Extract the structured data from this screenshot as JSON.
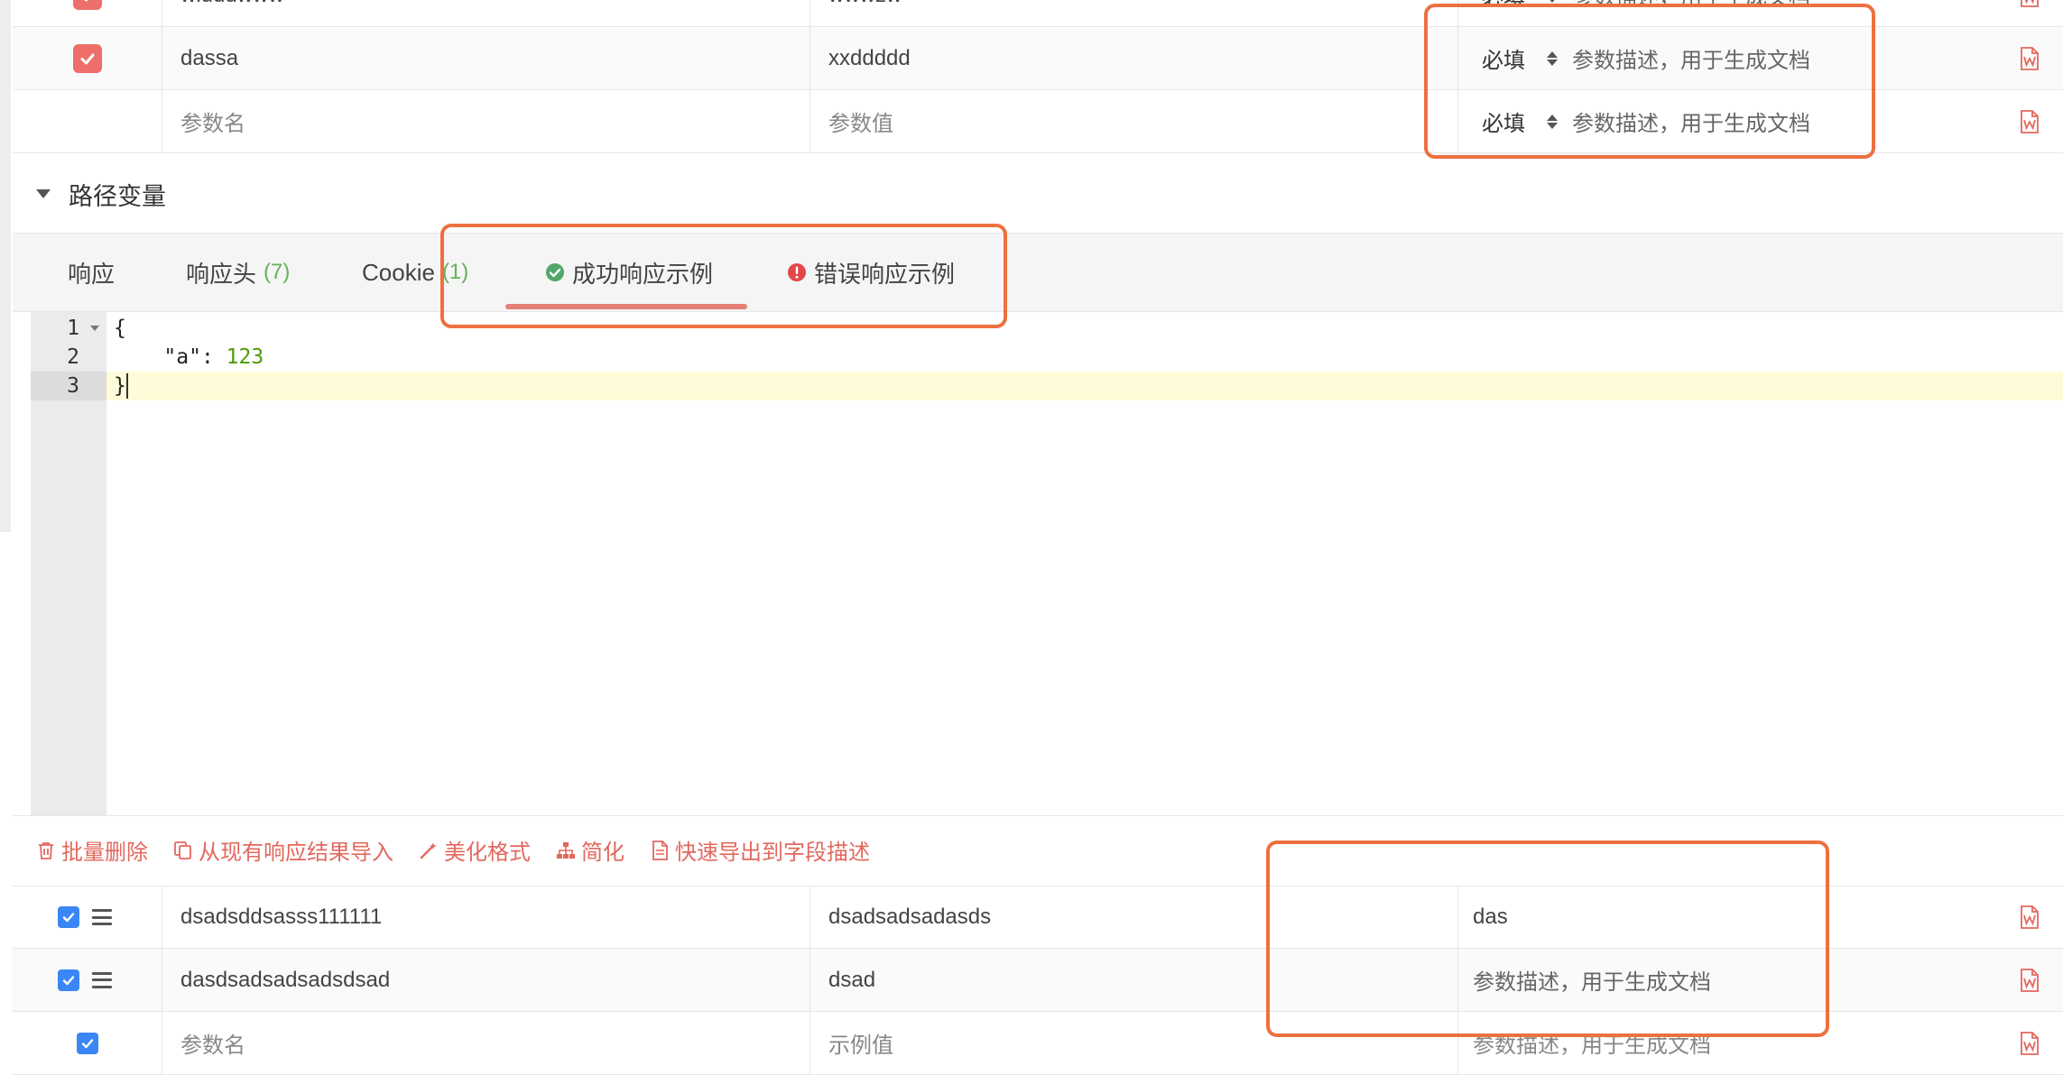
{
  "top_rows": [
    {
      "name": "widddwww",
      "value": "wwwzw",
      "required": "必填",
      "description": "参数描述，用于生成文档",
      "checked": true
    },
    {
      "name": "dassa",
      "value": "xxddddd",
      "required": "必填",
      "description": "参数描述，用于生成文档",
      "checked": true
    },
    {
      "name": "参数名",
      "value": "参数值",
      "required": "必填",
      "description": "参数描述，用于生成文档",
      "checked": false
    }
  ],
  "section": {
    "title": "路径变量"
  },
  "tabs": [
    {
      "label": "响应",
      "count": ""
    },
    {
      "label": "响应头",
      "count": "(7)"
    },
    {
      "label": "Cookie",
      "count": "(1)"
    },
    {
      "label": "成功响应示例",
      "count": ""
    },
    {
      "label": "错误响应示例",
      "count": ""
    }
  ],
  "editor": {
    "line_numbers": [
      "1",
      "2",
      "3"
    ],
    "lines": [
      {
        "text": "{"
      },
      {
        "key": "\"a\"",
        "sep": ": ",
        "value": "123"
      },
      {
        "text": "}"
      }
    ]
  },
  "toolbar": {
    "batch_delete": "批量删除",
    "import_from_response": "从现有响应结果导入",
    "beautify": "美化格式",
    "simplify": "简化",
    "export_to_fields": "快速导出到字段描述"
  },
  "bottom_rows": [
    {
      "name": "dsadsddsasss111111",
      "value": "dsadsadsadasds",
      "description": "das"
    },
    {
      "name": "dasdsadsadsadsdsad",
      "value": "dsad",
      "description": "参数描述，用于生成文档"
    },
    {
      "name": "参数名",
      "value": "示例值",
      "description": "参数描述，用于生成文档"
    }
  ],
  "colors": {
    "accent_red": "#ee6e6a",
    "checkbox_blue": "#3a86f5",
    "highlight_orange": "#ee7040",
    "count_green": "#67b05a",
    "success_green": "#52a86a",
    "error_red": "#e0484a"
  }
}
